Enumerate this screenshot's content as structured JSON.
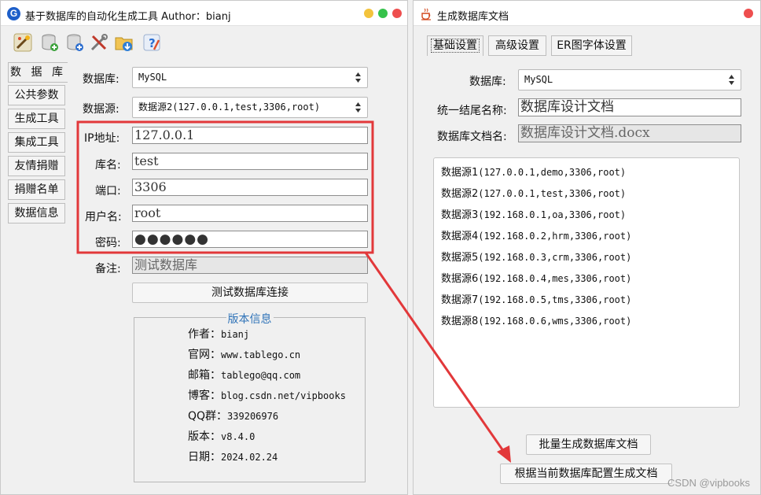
{
  "left_window": {
    "title": "基于数据库的自动化生成工具  Author：bianj",
    "logo_letter": "G",
    "title_dots": [
      "#f3c33c",
      "#35c24b",
      "#ee4e4e"
    ],
    "toolbar_icons": [
      "wand-icon",
      "database-add-icon",
      "database-new-icon",
      "tools-icon",
      "folder-download-icon",
      "help-icon"
    ],
    "side_tabs": [
      "数 据 库",
      "公共参数",
      "生成工具",
      "集成工具",
      "友情捐赠",
      "捐赠名单",
      "数据信息"
    ],
    "form": {
      "db_label": "数据库:",
      "db_value": "MySQL",
      "ds_label": "数据源:",
      "ds_value": "数据源2(127.0.0.1,test,3306,root)",
      "ip_label": "IP地址:",
      "ip_value": "127.0.0.1",
      "dbname_label": "库名:",
      "dbname_value": "test",
      "port_label": "端口:",
      "port_value": "3306",
      "user_label": "用户名:",
      "user_value": "root",
      "pwd_label": "密码:",
      "pwd_value": "●●●●●●",
      "note_label": "备注:",
      "note_value": "测试数据库",
      "test_button": "测试数据库连接"
    },
    "version_info": {
      "title": "版本信息",
      "lines": [
        {
          "k": "作者：",
          "v": "bianj"
        },
        {
          "k": "官网：",
          "v": "www.tablego.cn"
        },
        {
          "k": "邮箱：",
          "v": "tablego@qq.com"
        },
        {
          "k": "博客：",
          "v": "blog.csdn.net/vipbooks"
        },
        {
          "k": "QQ群：",
          "v": "339206976"
        },
        {
          "k": "版本：",
          "v": "v8.4.0"
        },
        {
          "k": "日期：",
          "v": "2024.02.24"
        }
      ]
    }
  },
  "right_window": {
    "title": "生成数据库文档",
    "tabs": [
      "基础设置",
      "高级设置",
      "ER图字体设置"
    ],
    "db_label": "数据库:",
    "db_value": "MySQL",
    "suffix_label": "统一结尾名称:",
    "suffix_value": "数据库设计文档",
    "docname_label": "数据库文档名:",
    "docname_value": "数据库设计文档.docx",
    "datasources": [
      {
        "n": "数据源1",
        "d": "(127.0.0.1,demo,3306,root)"
      },
      {
        "n": "数据源2",
        "d": "(127.0.0.1,test,3306,root)"
      },
      {
        "n": "数据源3",
        "d": "(192.168.0.1,oa,3306,root)"
      },
      {
        "n": "数据源4",
        "d": "(192.168.0.2,hrm,3306,root)"
      },
      {
        "n": "数据源5",
        "d": "(192.168.0.3,crm,3306,root)"
      },
      {
        "n": "数据源6",
        "d": "(192.168.0.4,mes,3306,root)"
      },
      {
        "n": "数据源7",
        "d": "(192.168.0.5,tms,3306,root)"
      },
      {
        "n": "数据源8",
        "d": "(192.168.0.6,wms,3306,root)"
      }
    ],
    "batch_button": "批量生成数据库文档",
    "current_button": "根据当前数据库配置生成文档"
  },
  "highlight_color": "#e2383a",
  "watermark": "CSDN @vipbooks"
}
